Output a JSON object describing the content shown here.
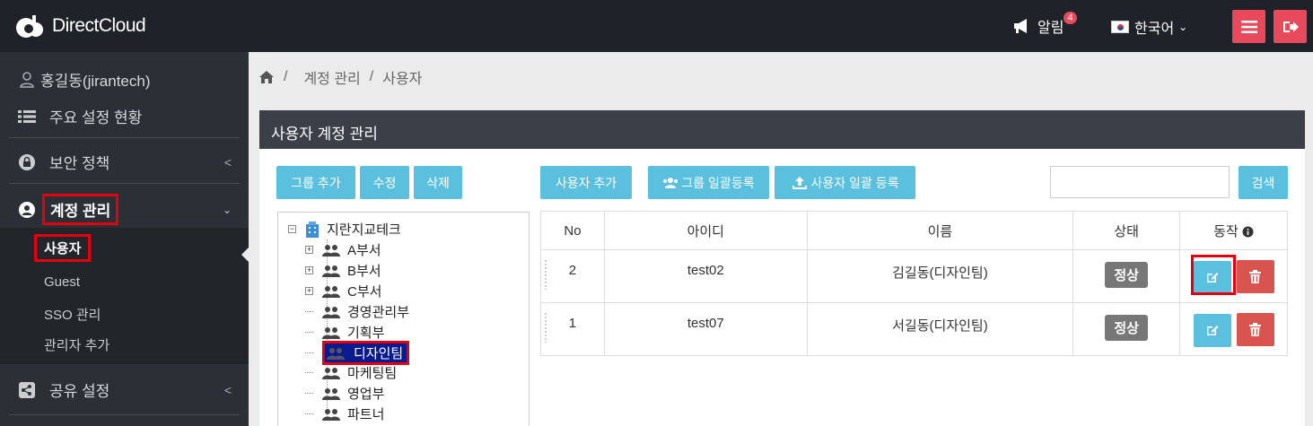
{
  "app": {
    "logo_text": "DirectCloud"
  },
  "header": {
    "notifications_label": "알림",
    "notifications_count": "4",
    "language": "한국어"
  },
  "sidebar": {
    "user": "홍길동(jirantech)",
    "items": [
      {
        "label": "주요 설정 현황",
        "icon": "list-icon"
      },
      {
        "label": "보안 정책",
        "icon": "lock-icon"
      },
      {
        "label": "계정 관리",
        "icon": "user-icon"
      },
      {
        "label": "공유 설정",
        "icon": "share-icon"
      }
    ],
    "sub_items": [
      "사용자",
      "Guest",
      "SSO 관리",
      "관리자 추가"
    ]
  },
  "breadcrumb": [
    "계정 관리",
    "사용자"
  ],
  "panel": {
    "title": "사용자 계정 관리",
    "buttons": {
      "group_add": "그룹 추가",
      "edit": "수정",
      "delete": "삭제",
      "user_add": "사용자 추가",
      "group_bulk": "그룹 일괄등록",
      "user_bulk": "사용자 일괄 등록",
      "search": "검색"
    },
    "search_placeholder": ""
  },
  "tree": {
    "root": "지란지교테크",
    "nodes": [
      "A부서",
      "B부서",
      "C부서",
      "경영관리부",
      "기획부",
      "디자인팀",
      "마케팅팀",
      "영업부",
      "파트너"
    ],
    "selected": "디자인팀"
  },
  "table": {
    "headers": [
      "No",
      "아이디",
      "이름",
      "상태",
      "동작"
    ],
    "rows": [
      {
        "no": "2",
        "id": "test02",
        "name": "김길동(디자인팀)",
        "status": "정상"
      },
      {
        "no": "1",
        "id": "test07",
        "name": "서길동(디자인팀)",
        "status": "정상"
      }
    ]
  },
  "colors": {
    "accent": "#5bc0de",
    "danger": "#d9534f",
    "topbar": "#1f2329",
    "header_red": "#e8495b"
  }
}
